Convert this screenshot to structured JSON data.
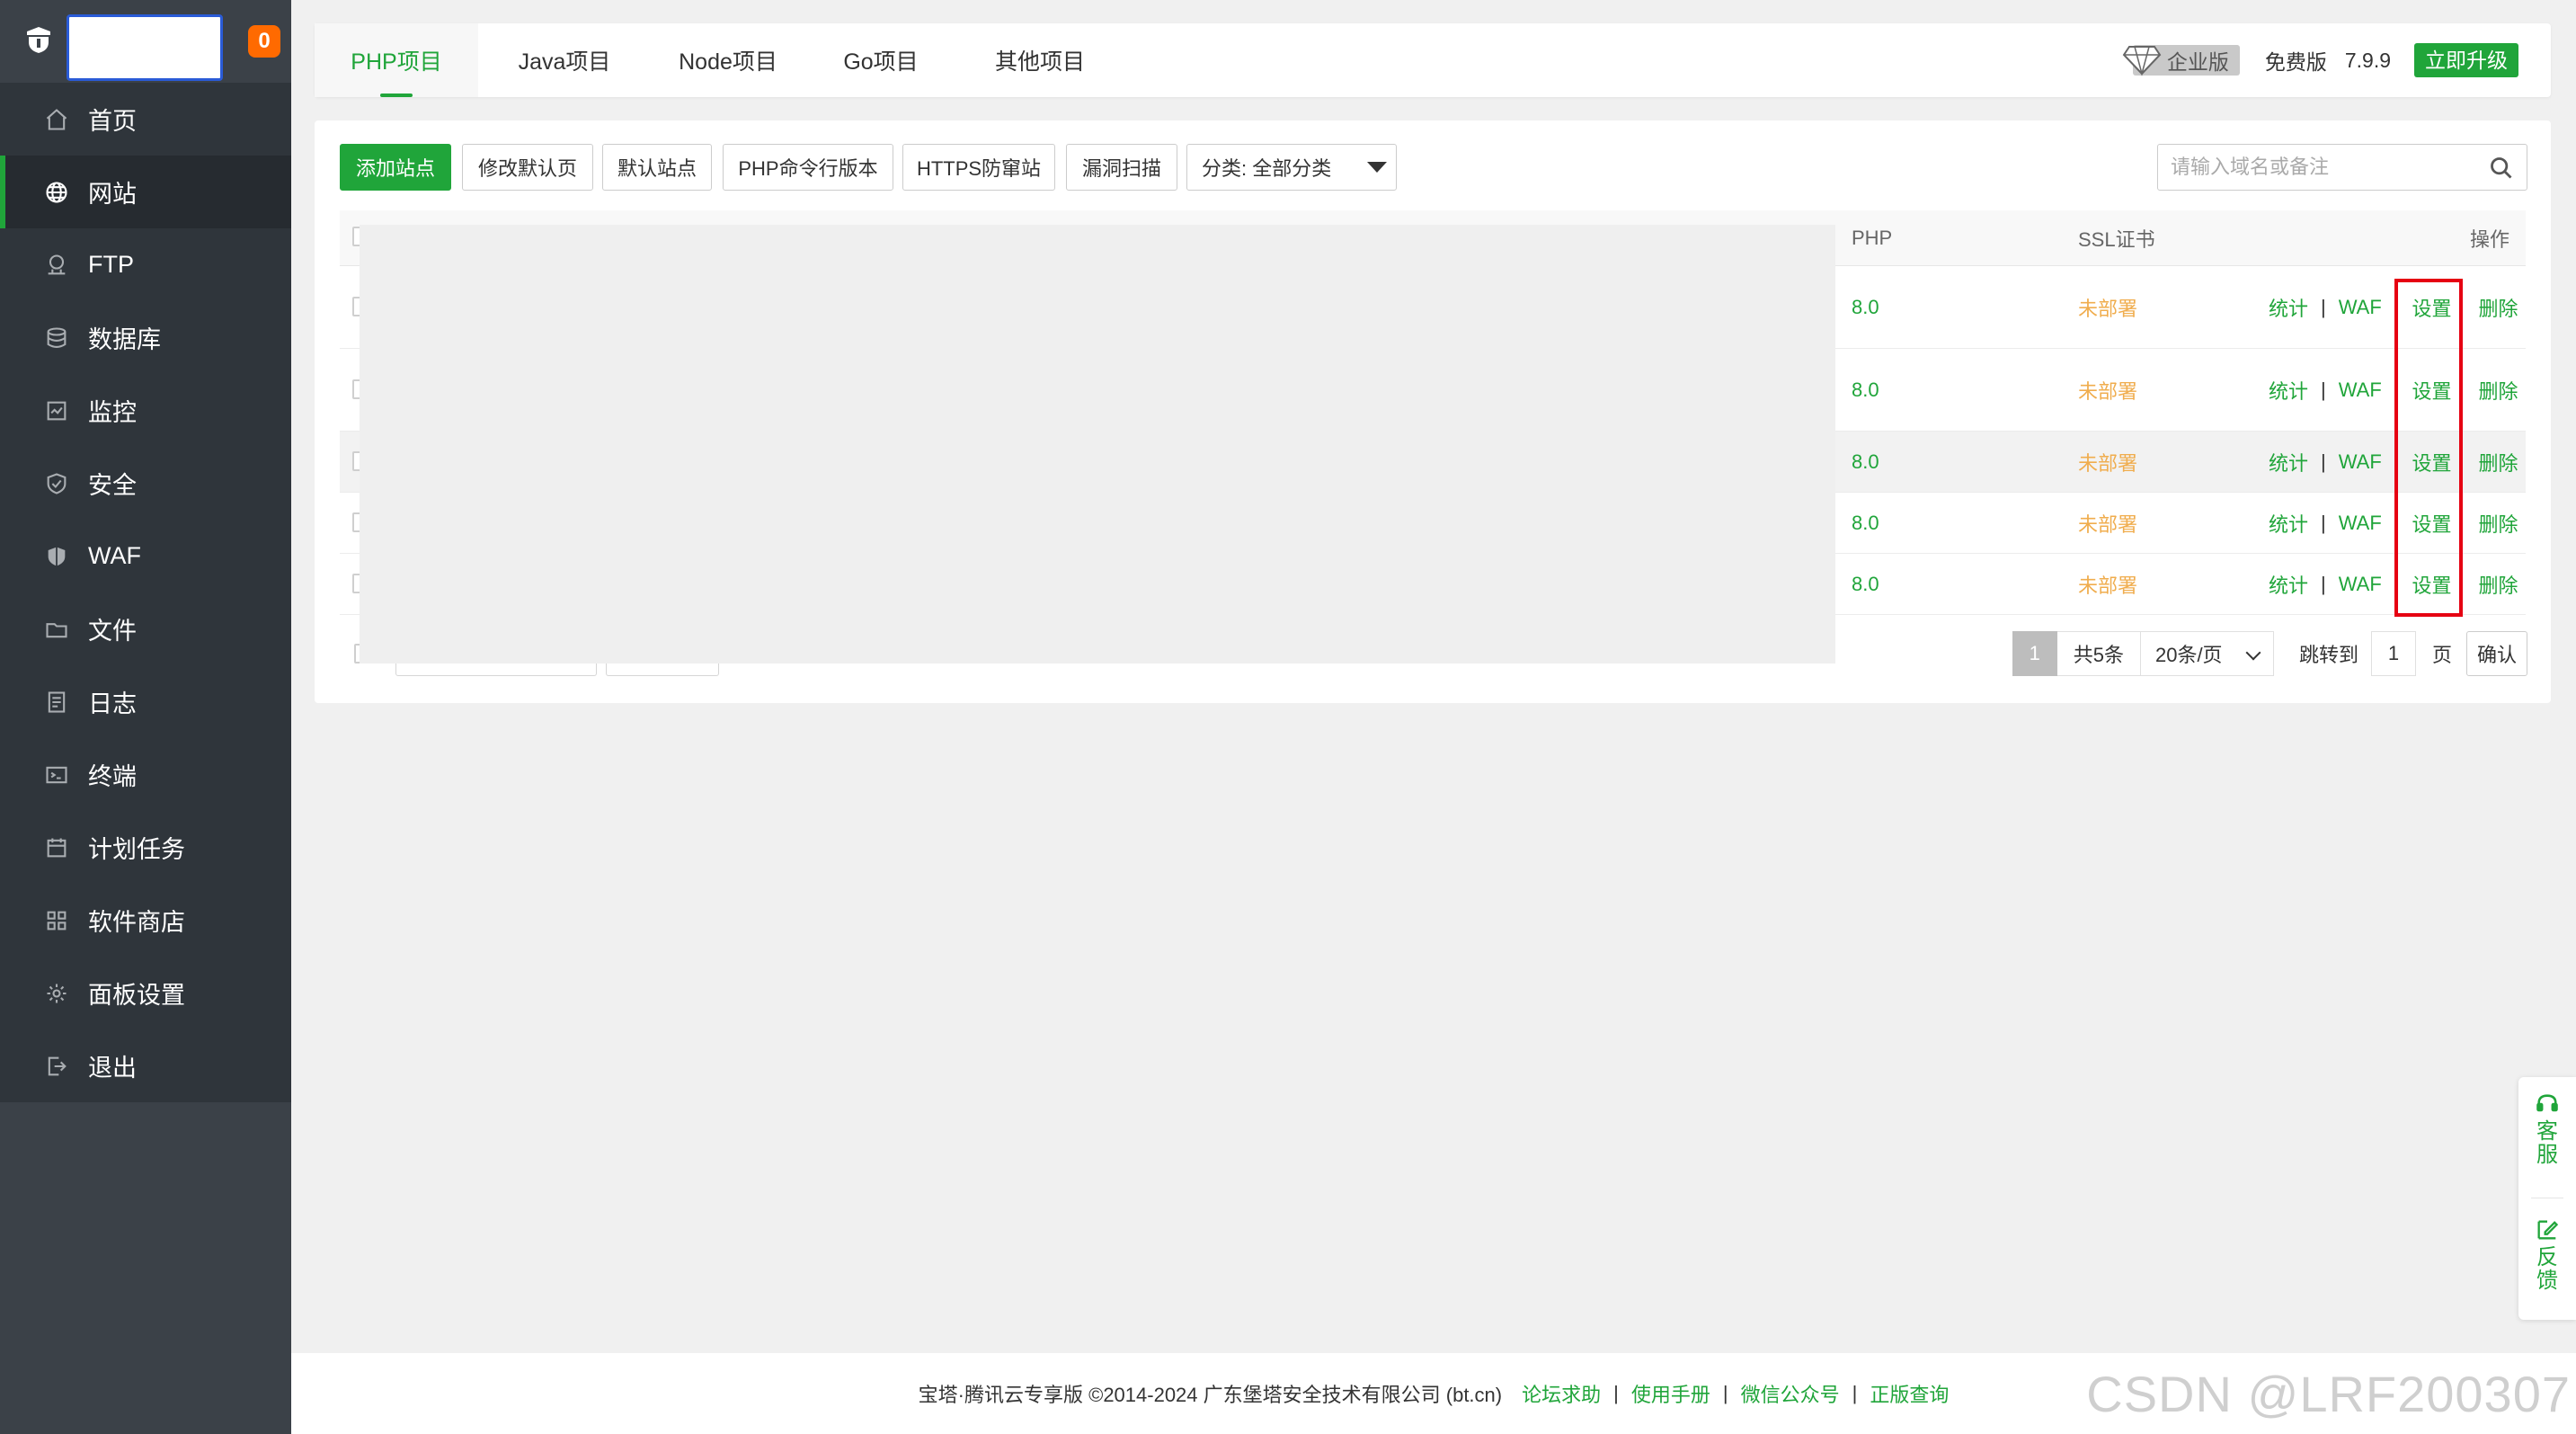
{
  "sidebar": {
    "badge": "0",
    "items": [
      {
        "label": "首页",
        "icon": "home-icon"
      },
      {
        "label": "网站",
        "icon": "globe-icon",
        "active": true
      },
      {
        "label": "FTP",
        "icon": "ftp-icon"
      },
      {
        "label": "数据库",
        "icon": "database-icon"
      },
      {
        "label": "监控",
        "icon": "monitor-icon"
      },
      {
        "label": "安全",
        "icon": "shield-icon"
      },
      {
        "label": "WAF",
        "icon": "waf-shield-icon"
      },
      {
        "label": "文件",
        "icon": "folder-icon"
      },
      {
        "label": "日志",
        "icon": "log-icon"
      },
      {
        "label": "终端",
        "icon": "terminal-icon"
      },
      {
        "label": "计划任务",
        "icon": "calendar-icon"
      },
      {
        "label": "软件商店",
        "icon": "apps-icon"
      },
      {
        "label": "面板设置",
        "icon": "gear-icon"
      },
      {
        "label": "退出",
        "icon": "logout-icon"
      }
    ]
  },
  "tabs": [
    "PHP项目",
    "Java项目",
    "Node项目",
    "Go项目",
    "其他项目"
  ],
  "topright": {
    "enterprise": "企业版",
    "free": "免费版",
    "version": "7.9.9",
    "upgrade": "立即升级"
  },
  "toolbar": {
    "add": "添加站点",
    "modify_default": "修改默认页",
    "default_site": "默认站点",
    "php_cli": "PHP命令行版本",
    "https_guard": "HTTPS防窜站",
    "vuln_scan": "漏洞扫描",
    "category": "分类: 全部分类",
    "search_placeholder": "请输入域名或备注"
  },
  "table": {
    "headers": {
      "php": "PHP",
      "ssl": "SSL证书",
      "ops": "操作"
    },
    "rows": [
      {
        "php": "8.0",
        "ssl": "未部署"
      },
      {
        "php": "8.0",
        "ssl": "未部署"
      },
      {
        "php": "8.0",
        "ssl": "未部署"
      },
      {
        "php": "8.0",
        "ssl": "未部署"
      },
      {
        "php": "8.0",
        "ssl": "未部署"
      }
    ],
    "ops": {
      "stats": "统计",
      "waf": "WAF",
      "settings": "设置",
      "delete": "删除"
    }
  },
  "pager": {
    "current": "1",
    "total": "共5条",
    "size": "20条/页",
    "jump": "跳转到",
    "page_input": "1",
    "unit": "页",
    "ok": "确认"
  },
  "footer": {
    "copyright": "宝塔·腾讯云专享版 ©2014-2024 广东堡塔安全技术有限公司 (bt.cn)",
    "links": [
      "论坛求助",
      "使用手册",
      "微信公众号",
      "正版查询"
    ]
  },
  "float": {
    "service": "客服",
    "feedback": "反馈"
  },
  "watermark": "CSDN @LRF200307"
}
